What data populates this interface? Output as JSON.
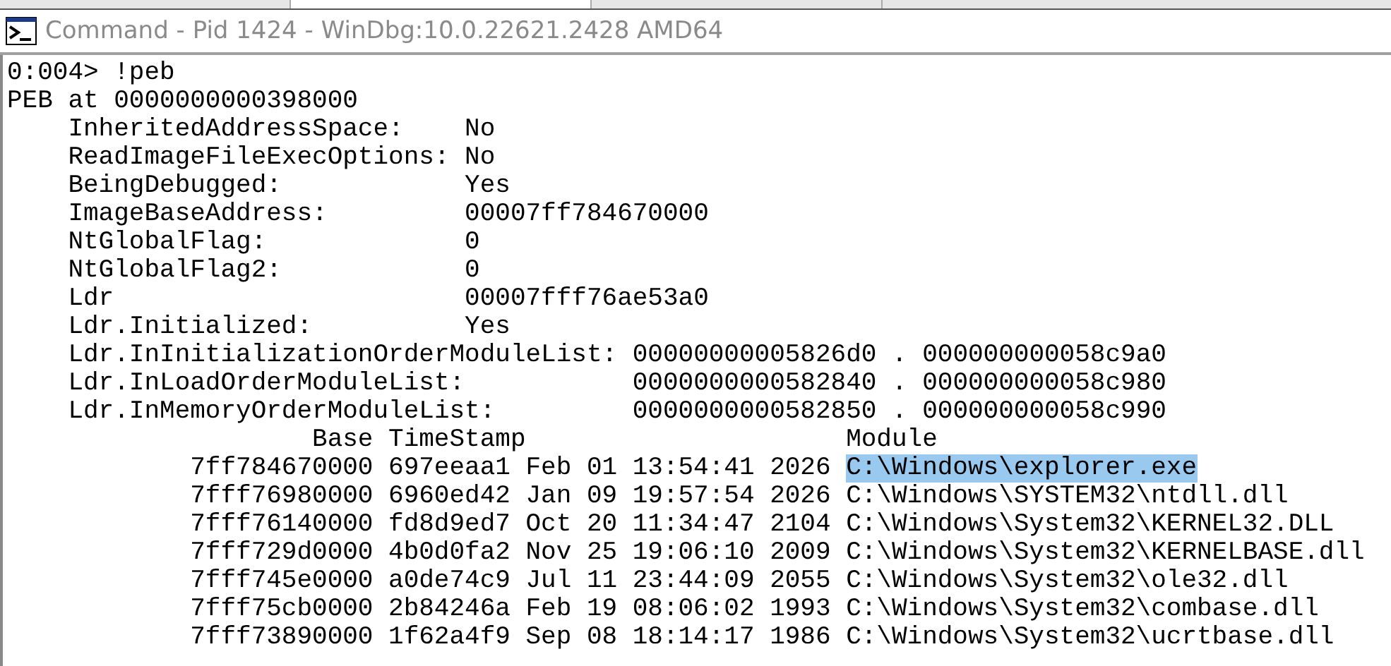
{
  "window": {
    "title": "Command - Pid 1424 - WinDbg:10.0.22621.2428 AMD64"
  },
  "tab_strip": [
    {
      "selected": false
    },
    {
      "selected": true
    },
    {
      "selected": false
    }
  ],
  "command_line": "0:004> !peb",
  "peb_address": "PEB at 0000000000398000",
  "peb_fields": [
    {
      "name": "InheritedAddressSpace:",
      "value": "No"
    },
    {
      "name": "ReadImageFileExecOptions:",
      "value": "No"
    },
    {
      "name": "BeingDebugged:",
      "value": "Yes"
    },
    {
      "name": "ImageBaseAddress:",
      "value": "00007ff784670000"
    },
    {
      "name": "NtGlobalFlag:",
      "value": "0"
    },
    {
      "name": "NtGlobalFlag2:",
      "value": "0"
    },
    {
      "name": "Ldr",
      "value": "00007fff76ae53a0"
    },
    {
      "name": "Ldr.Initialized:",
      "value": "Yes"
    }
  ],
  "module_lists": [
    {
      "name": "Ldr.InInitializationOrderModuleList:",
      "value": "00000000005826d0 . 000000000058c9a0"
    },
    {
      "name": "Ldr.InLoadOrderModuleList:",
      "value": "0000000000582840 . 000000000058c980"
    },
    {
      "name": "Ldr.InMemoryOrderModuleList:",
      "value": "0000000000582850 . 000000000058c990"
    }
  ],
  "module_table": {
    "columns": [
      "Base",
      "TimeStamp",
      "Module"
    ],
    "rows": [
      {
        "base": "7ff784670000",
        "timestamp": "697eeaa1",
        "date": "Feb 01 13:54:41 2026",
        "module": "C:\\Windows\\explorer.exe",
        "selected": true
      },
      {
        "base": "7fff76980000",
        "timestamp": "6960ed42",
        "date": "Jan 09 19:57:54 2026",
        "module": "C:\\Windows\\SYSTEM32\\ntdll.dll",
        "selected": false
      },
      {
        "base": "7fff76140000",
        "timestamp": "fd8d9ed7",
        "date": "Oct 20 11:34:47 2104",
        "module": "C:\\Windows\\System32\\KERNEL32.DLL",
        "selected": false
      },
      {
        "base": "7fff729d0000",
        "timestamp": "4b0d0fa2",
        "date": "Nov 25 19:06:10 2009",
        "module": "C:\\Windows\\System32\\KERNELBASE.dll",
        "selected": false
      },
      {
        "base": "7fff745e0000",
        "timestamp": "a0de74c9",
        "date": "Jul 11 23:44:09 2055",
        "module": "C:\\Windows\\System32\\ole32.dll",
        "selected": false
      },
      {
        "base": "7fff75cb0000",
        "timestamp": "2b84246a",
        "date": "Feb 19 08:06:02 1993",
        "module": "C:\\Windows\\System32\\combase.dll",
        "selected": false
      },
      {
        "base": "7fff73890000",
        "timestamp": "1f62a4f9",
        "date": "Sep 08 18:14:17 1986",
        "module": "C:\\Windows\\System32\\ucrtbase.dll",
        "selected": false
      }
    ]
  }
}
